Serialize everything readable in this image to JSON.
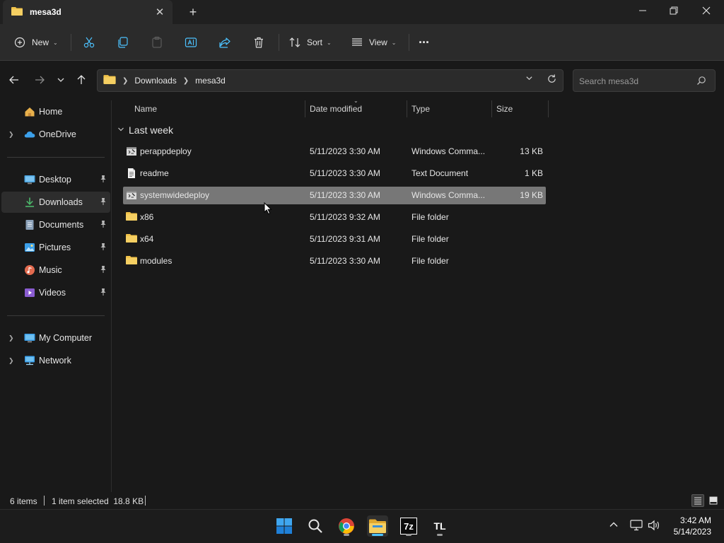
{
  "window": {
    "tab_title": "mesa3d",
    "new_tab_glyph": "+",
    "close_tab_glyph": "✕"
  },
  "toolbar": {
    "new_label": "New",
    "sort_label": "Sort",
    "view_label": "View",
    "more_glyph": "···",
    "icons": [
      "cut-icon",
      "copy-icon",
      "paste-icon",
      "rename-icon",
      "share-icon",
      "delete-icon"
    ]
  },
  "address": {
    "crumbs": [
      "Downloads",
      "mesa3d"
    ]
  },
  "search": {
    "placeholder": "Search mesa3d"
  },
  "sidebar": {
    "items": [
      {
        "label": "Home",
        "icon": "home-icon",
        "color": "#e8b04b",
        "expand": false,
        "pinned": false
      },
      {
        "label": "OneDrive",
        "icon": "cloud-icon",
        "color": "#3ca0ea",
        "expand": true,
        "pinned": false
      },
      {
        "label": "Desktop",
        "icon": "desktop-icon",
        "color": "#4aa3df",
        "expand": false,
        "pinned": true
      },
      {
        "label": "Downloads",
        "icon": "download-icon",
        "color": "#4cb86b",
        "expand": false,
        "pinned": true,
        "active": true
      },
      {
        "label": "Documents",
        "icon": "document-icon",
        "color": "#8aa0b8",
        "expand": false,
        "pinned": true
      },
      {
        "label": "Pictures",
        "icon": "pictures-icon",
        "color": "#3ca0ea",
        "expand": false,
        "pinned": true
      },
      {
        "label": "Music",
        "icon": "music-icon",
        "color": "#e36b4f",
        "expand": false,
        "pinned": true
      },
      {
        "label": "Videos",
        "icon": "videos-icon",
        "color": "#8a5cd1",
        "expand": false,
        "pinned": true
      },
      {
        "label": "My Computer",
        "icon": "computer-icon",
        "color": "#3ca0ea",
        "expand": true,
        "pinned": false
      },
      {
        "label": "Network",
        "icon": "network-icon",
        "color": "#3ca0ea",
        "expand": true,
        "pinned": false
      }
    ]
  },
  "columns": {
    "name": "Name",
    "date": "Date modified",
    "type": "Type",
    "size": "Size"
  },
  "group_label": "Last week",
  "files": [
    {
      "name": "perappdeploy",
      "date": "5/11/2023 3:30 AM",
      "type": "Windows Comma...",
      "size": "13 KB",
      "icon": "cmd-file-icon",
      "selected": false
    },
    {
      "name": "readme",
      "date": "5/11/2023 3:30 AM",
      "type": "Text Document",
      "size": "1 KB",
      "icon": "text-file-icon",
      "selected": false
    },
    {
      "name": "systemwidedeploy",
      "date": "5/11/2023 3:30 AM",
      "type": "Windows Comma...",
      "size": "19 KB",
      "icon": "cmd-file-icon",
      "selected": true
    },
    {
      "name": "x86",
      "date": "5/11/2023 9:32 AM",
      "type": "File folder",
      "size": "",
      "icon": "folder-icon",
      "selected": false
    },
    {
      "name": "x64",
      "date": "5/11/2023 9:31 AM",
      "type": "File folder",
      "size": "",
      "icon": "folder-icon",
      "selected": false
    },
    {
      "name": "modules",
      "date": "5/11/2023 3:30 AM",
      "type": "File folder",
      "size": "",
      "icon": "folder-icon",
      "selected": false
    }
  ],
  "status": {
    "item_count": "6 items",
    "selection": "1 item selected  18.8 KB"
  },
  "taskbar": {
    "time": "3:42 AM",
    "date": "5/14/2023",
    "apps": [
      "start-icon",
      "search-icon",
      "chrome-icon",
      "file-explorer-icon",
      "7zip-icon",
      "tl-app-icon"
    ],
    "app_7z_label": "7z",
    "app_tl_label": "TL"
  },
  "colors": {
    "accent": "#4cc2ff",
    "folder": "#f0c24a",
    "selection": "#777777"
  }
}
